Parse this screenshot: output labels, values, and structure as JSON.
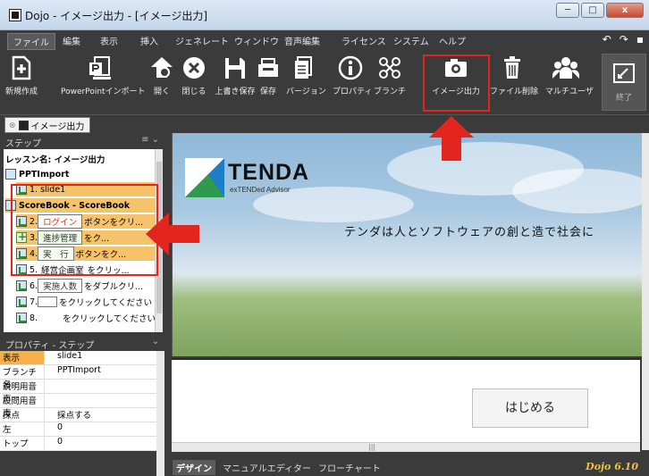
{
  "window": {
    "title": "Dojo - イメージ出力 - [イメージ出力]",
    "controls": [
      "─",
      "□",
      "x"
    ]
  },
  "menu": {
    "items": [
      "ファイル",
      "編集",
      "表示",
      "挿入",
      "ジェネレート",
      "ウィンドウ",
      "音声編集",
      "ライセンス",
      "システム",
      "ヘルプ"
    ]
  },
  "toolbar": {
    "buttons": [
      {
        "label": "新規作成",
        "icon": "new-file-icon"
      },
      {
        "label": "PowerPointインポート",
        "icon": "powerpoint-import-icon"
      },
      {
        "label": "開く",
        "icon": "open-icon"
      },
      {
        "label": "閉じる",
        "icon": "close-circle-icon"
      },
      {
        "label": "上書き保存",
        "icon": "overwrite-save-icon"
      },
      {
        "label": "保存",
        "icon": "save-icon"
      },
      {
        "label": "バージョン",
        "icon": "version-icon"
      },
      {
        "label": "プロパティ",
        "icon": "info-icon"
      },
      {
        "label": "ブランチ",
        "icon": "branch-icon"
      },
      {
        "label": "イメージ出力",
        "icon": "camera-icon"
      },
      {
        "label": "ファイル削除",
        "icon": "trash-icon"
      },
      {
        "label": "マルチユーザ",
        "icon": "multi-user-icon"
      },
      {
        "label": "終了",
        "icon": "exit-icon"
      }
    ]
  },
  "doc_tab": {
    "label": "イメージ出力"
  },
  "step_panel": {
    "title": "ステップ",
    "rows": [
      {
        "text": "レッスン名: イメージ出力",
        "bold": true
      },
      {
        "text": "PPTImport",
        "bold": true
      },
      {
        "text": "1. slide1"
      },
      {
        "text": "ScoreBook - ScoreBook",
        "bold": true
      },
      {
        "num": "2.",
        "btn": "ログイン",
        "text": "ボタンをクリ..."
      },
      {
        "num": "3.",
        "btn": "進捗管理",
        "text": "をク..."
      },
      {
        "num": "4.",
        "btn": "実　行",
        "text": "ボタンをク..."
      },
      {
        "num": "5.",
        "btn": "経営企画室",
        "text": "をクリッ..."
      },
      {
        "num": "6.",
        "btn": "実施人数",
        "text": "をダブルクリ..."
      },
      {
        "num": "7.",
        "btn": "",
        "text": "をクリックしてください"
      },
      {
        "num": "8.",
        "btn": "",
        "text": "をクリックしてください"
      }
    ]
  },
  "property_panel": {
    "title": "プロパティ - ステップ",
    "rows": [
      {
        "key": "表示",
        "value": "slide1"
      },
      {
        "key": "ブランチ名",
        "value": "PPTImport"
      },
      {
        "key": "説明用音声",
        "value": ""
      },
      {
        "key": "設問用音声",
        "value": ""
      },
      {
        "key": "採点",
        "value": "採点する"
      },
      {
        "key": "左",
        "value": "0"
      },
      {
        "key": "トップ",
        "value": "0"
      }
    ]
  },
  "slide": {
    "brand": "TENDA",
    "tagline": "exTENDed Advisor",
    "slogan": "テンダは人とソフトウェアの創と造で社会に",
    "start_button": "はじめる"
  },
  "bottom_tabs": [
    "デザイン",
    "マニュアルエディター",
    "フローチャート"
  ],
  "version": "Dojo 6.10",
  "colors": {
    "accent_red": "#e2261f",
    "selection": "#f6c36b",
    "ribbon": "#3b3b3b"
  }
}
